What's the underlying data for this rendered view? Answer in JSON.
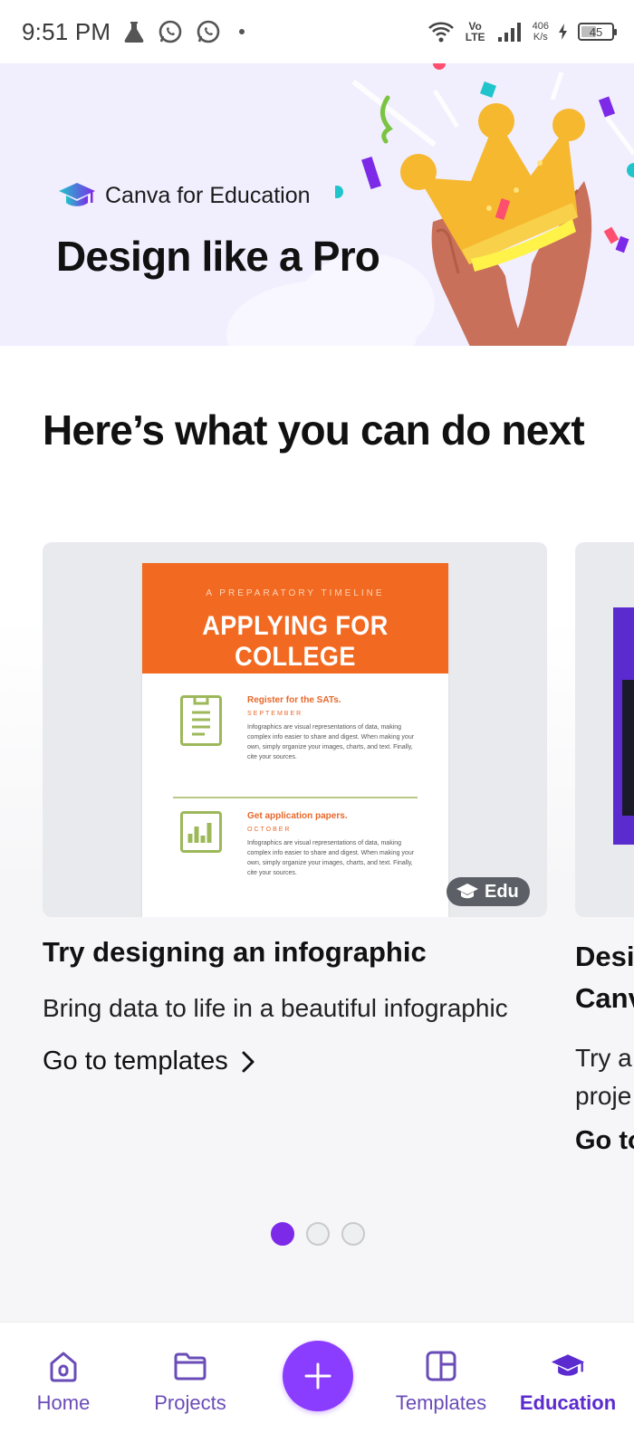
{
  "status_bar": {
    "time": "9:51 PM",
    "net_speed_value": "406",
    "net_speed_unit": "K/s",
    "network_type": "Vo LTE",
    "battery": "45"
  },
  "hero": {
    "brand": "Canva for Education",
    "title": "Design like a Pro"
  },
  "main": {
    "section_title": "Here’s what you can do next",
    "cards": [
      {
        "thumbnail": {
          "kicker": "A PREPARATORY TIMELINE",
          "title": "APPLYING FOR COLLEGE",
          "rows": [
            {
              "heading": "Register for the SATs.",
              "month": "SEPTEMBER",
              "body": "Infographics are visual representations of data, making complex info easier to share and digest. When making your own, simply organize your images, charts, and text. Finally, cite your sources."
            },
            {
              "heading": "Get application papers.",
              "month": "OCTOBER",
              "body": "Infographics are visual representations of data, making complex info easier to share and digest. When making your own, simply organize your images, charts, and text. Finally, cite your sources."
            }
          ],
          "badge": "Edu"
        },
        "title": "Try designing an infographic",
        "description": "Bring data to life in a beautiful infographic",
        "link": "Go to templates"
      },
      {
        "title_line1": "Desi",
        "title_line2": "Canv",
        "description_line1": "Try a",
        "description_line2": "proje",
        "link": "Go to"
      }
    ],
    "pagination": {
      "count": 3,
      "active": 0
    }
  },
  "bottom_nav": {
    "items": [
      {
        "label": "Home",
        "icon": "home-icon"
      },
      {
        "label": "Projects",
        "icon": "folder-icon"
      },
      {
        "label": "Templates",
        "icon": "templates-icon"
      },
      {
        "label": "Education",
        "icon": "graduation-cap-icon"
      }
    ],
    "create_icon": "plus-icon"
  },
  "colors": {
    "accent": "#8b3dff",
    "hero_background": "#f1eefe",
    "doc_orange": "#f26a22",
    "doc_green": "#9cb85a"
  }
}
